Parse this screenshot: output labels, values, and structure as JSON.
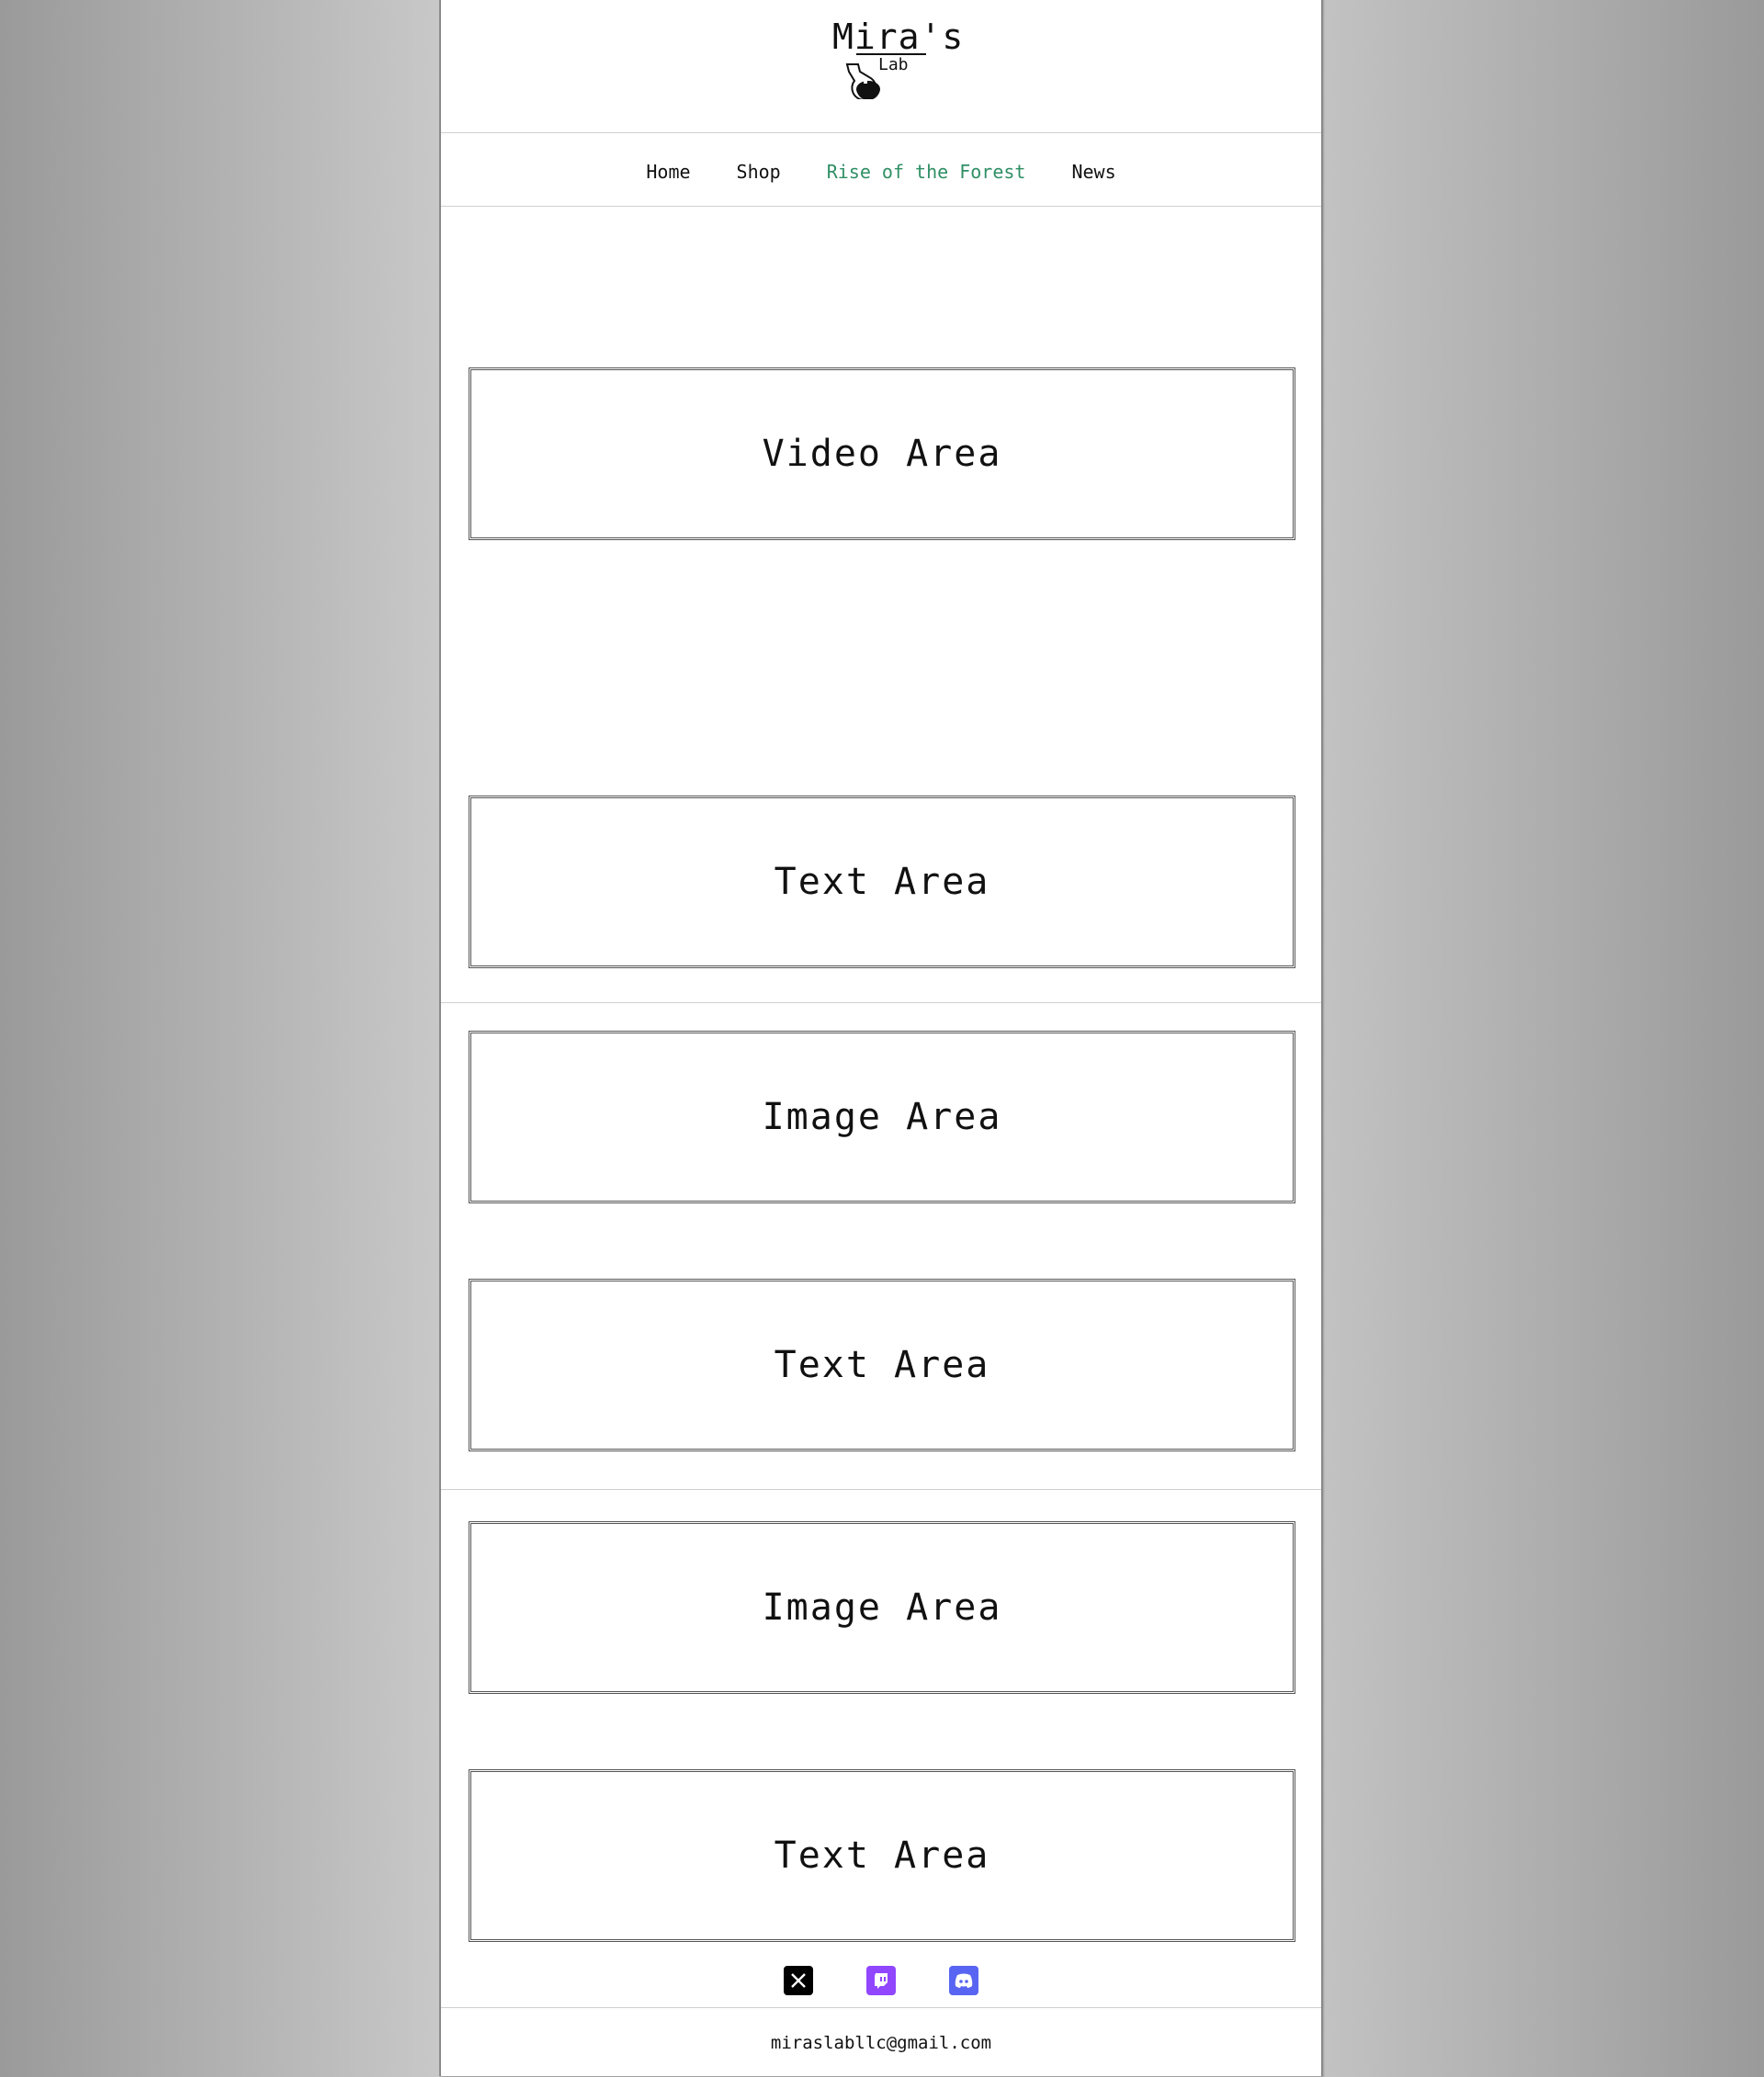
{
  "header": {
    "logo_title": "Mira's",
    "logo_sub": "Lab"
  },
  "nav": {
    "items": [
      {
        "label": "Home"
      },
      {
        "label": "Shop"
      },
      {
        "label": "Rise of the Forest"
      },
      {
        "label": "News"
      }
    ],
    "active_color": "#2f8f64"
  },
  "sections": {
    "video": "Video Area",
    "text1": "Text Area",
    "image1": "Image Area",
    "text2": "Text Area",
    "image2": "Image Area",
    "text3": "Text Area"
  },
  "social": {
    "icons": [
      "x-icon",
      "twitch-icon",
      "discord-icon"
    ],
    "colors": {
      "x": "#000000",
      "twitch": "#9146ff",
      "discord": "#5865f2"
    }
  },
  "footer": {
    "email": "miraslabllc@gmail.com"
  }
}
